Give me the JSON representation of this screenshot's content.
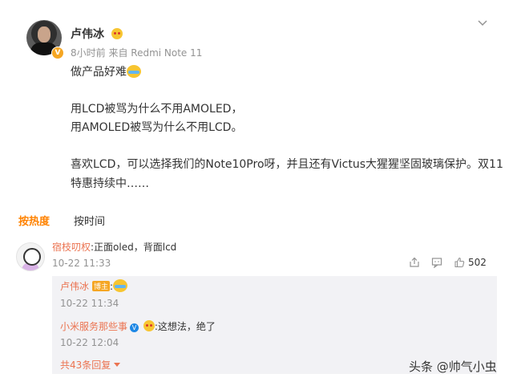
{
  "post": {
    "author": "卢伟冰",
    "meta": "8小时前  来自 Redmi Note 11",
    "line1": "做产品好难",
    "line2": "用LCD被骂为什么不用AMOLED，",
    "line3": "用AMOLED被骂为什么不用LCD。",
    "line4": "喜欢LCD，可以选择我们的Note10Pro呀，并且还有Victus大猩猩坚固玻璃保护。双11",
    "line5": "特惠持续中……"
  },
  "tabs": {
    "hot": "按热度",
    "time": "按时间"
  },
  "comment": {
    "username": "宿枝叨权",
    "text": ":正面oled，背面lcd",
    "time": "10-22 11:33",
    "likes": "502"
  },
  "replies": [
    {
      "username": "卢伟冰",
      "tag": "博主",
      "text": ":",
      "time": "10-22 11:34"
    },
    {
      "username": "小米服务那些事",
      "text": ":这想法，绝了",
      "time": "10-22 12:04"
    }
  ],
  "more_replies": "共43条回复",
  "watermark": "头条 @帅气小虫",
  "icons": {
    "menu": "chevron-down-icon",
    "share": "share-icon",
    "comment": "comment-icon",
    "like": "like-icon"
  },
  "colors": {
    "accent": "#ff8200",
    "username": "#eb7350",
    "muted": "#939393",
    "reply_bg": "#f2f2f5"
  }
}
